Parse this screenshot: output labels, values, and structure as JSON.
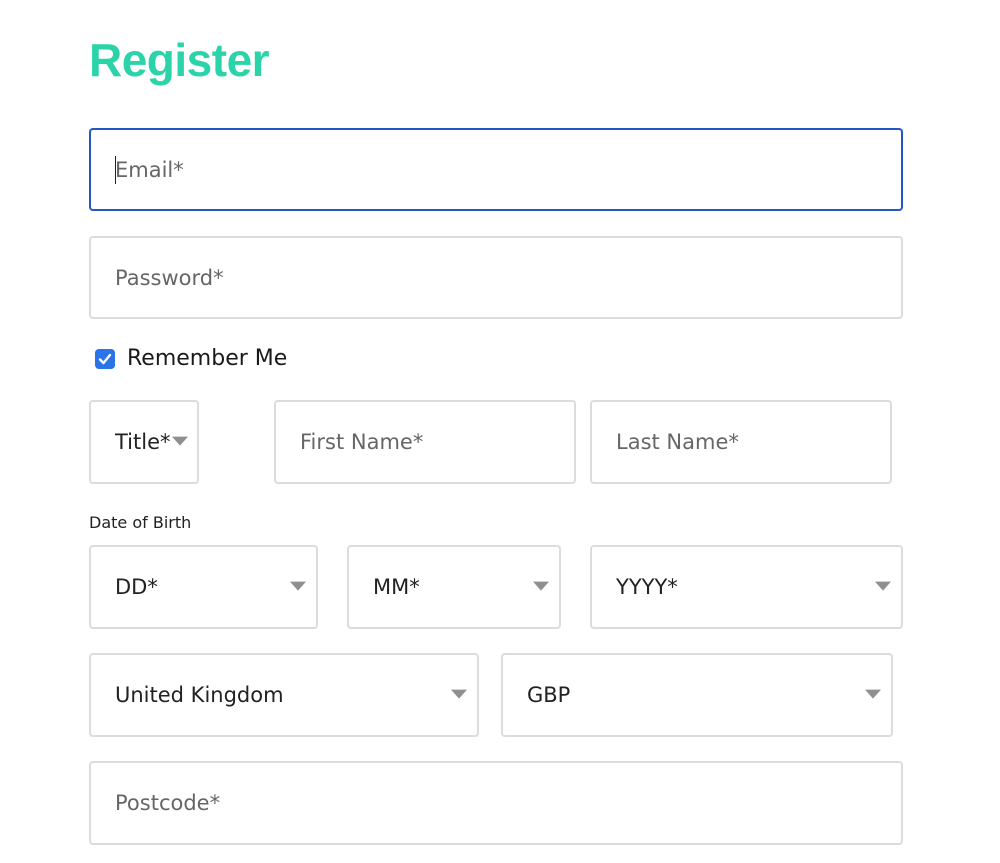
{
  "page": {
    "title": "Register",
    "accent_color": "#2bd4a8",
    "focus_color": "#2356c9"
  },
  "form": {
    "email": {
      "placeholder": "Email*",
      "value": "",
      "focused": true
    },
    "password": {
      "placeholder": "Password*",
      "value": ""
    },
    "remember_me": {
      "label": "Remember Me",
      "checked": true,
      "icon": "checkmark-icon"
    },
    "title_select": {
      "selected": "Title*",
      "icon": "chevron-down-icon"
    },
    "first_name": {
      "placeholder": "First Name*",
      "value": ""
    },
    "last_name": {
      "placeholder": "Last Name*",
      "value": ""
    },
    "dob": {
      "label": "Date of Birth",
      "day": {
        "selected": "DD*"
      },
      "month": {
        "selected": "MM*"
      },
      "year": {
        "selected": "YYYY*"
      }
    },
    "country": {
      "selected": "United Kingdom"
    },
    "currency": {
      "selected": "GBP"
    },
    "postcode": {
      "placeholder": "Postcode*",
      "value": ""
    }
  }
}
